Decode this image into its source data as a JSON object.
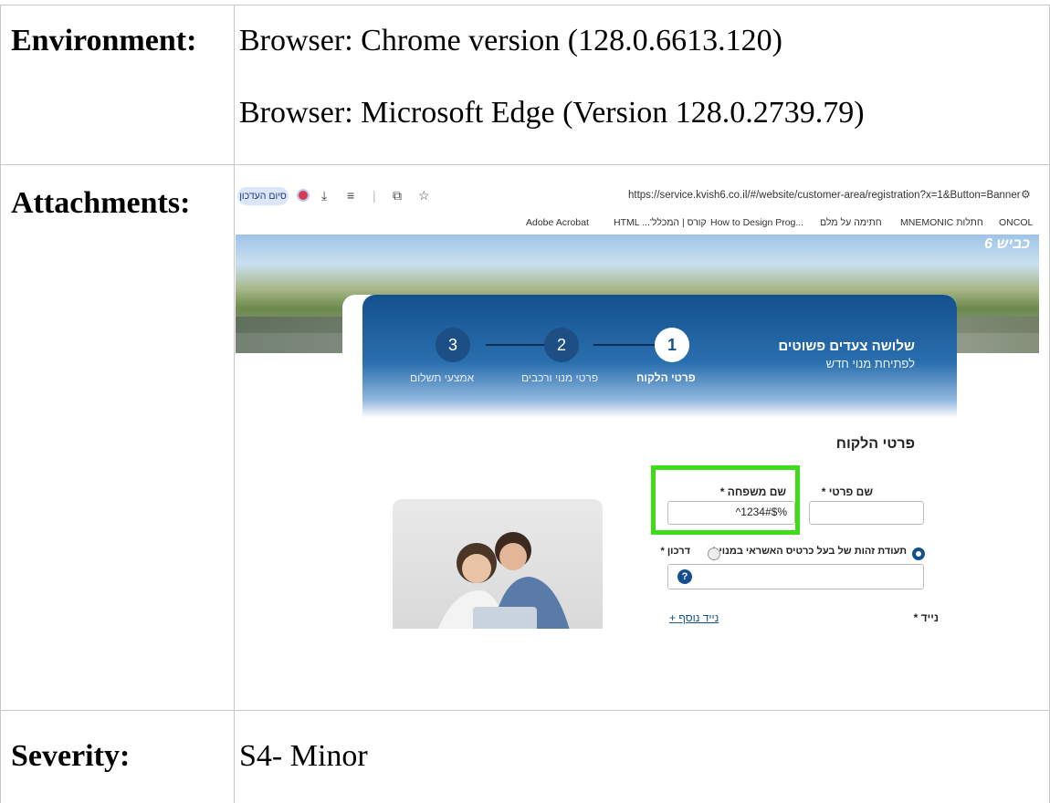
{
  "table": {
    "rows": [
      {
        "label": "Environment:",
        "lines": [
          "Browser: Chrome version (128.0.6613.120)",
          "Browser: Microsoft Edge (Version 128.0.2739.79)"
        ]
      },
      {
        "label": "Attachments:"
      },
      {
        "label": "Severity:",
        "value": "S4- Minor"
      }
    ]
  },
  "screenshot": {
    "browser": {
      "finish_button": "סיום העדכון",
      "url": "https://service.kvish6.co.il/#/website/customer-area/registration?x=1&Button=Banner",
      "bookmarks": [
        "Adobe Acrobat",
        "HTML ...'קורס | המכלל",
        "How to Design Prog...",
        "חתימה על מלם",
        "MNEMONIC חתלות",
        "ONCOL"
      ],
      "icons": [
        "record-icon",
        "download-icon",
        "reading-list-icon",
        "extensions-icon",
        "star-icon",
        "tune-icon"
      ]
    },
    "site": {
      "logo": "כביש 6",
      "header_title": "שלושה צעדים פשוטים",
      "header_subtitle": "לפתיחת מנוי חדש",
      "steps": [
        {
          "num": "1",
          "label": "פרטי הלקוח",
          "active": true
        },
        {
          "num": "2",
          "label": "פרטי מנוי ורכבים",
          "active": false
        },
        {
          "num": "3",
          "label": "אמצעי תשלום",
          "active": false
        }
      ],
      "section_title": "פרטי הלקוח",
      "first_name_label": "* שם פרטי",
      "last_name_label": "* שם משפחה",
      "last_name_value": "^1234#$%",
      "id_option_label": "* תעודת זהות של בעל כרטיס האשראי במנוי",
      "passport_option_label": "* דרכון",
      "mobile_label": "* נייד",
      "add_mobile_link": "+ נייד נוסף",
      "help_icon_text": "?"
    },
    "colors": {
      "highlight": "#3ddc1a",
      "brand_blue": "#14508e"
    }
  }
}
